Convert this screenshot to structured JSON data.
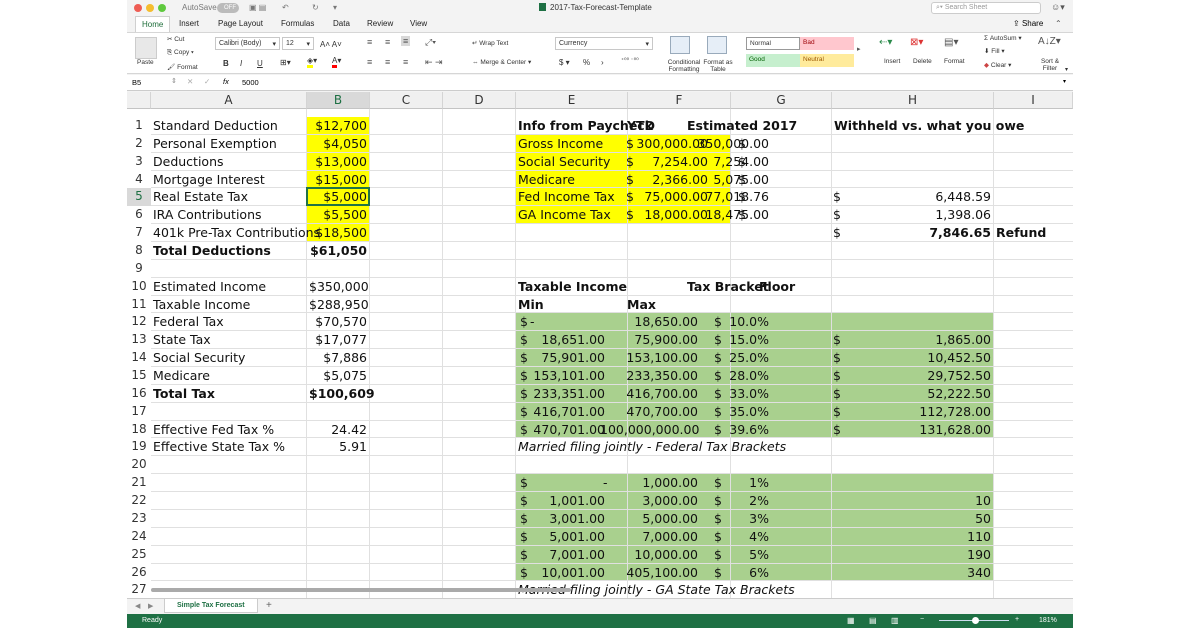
{
  "window": {
    "title": "2017-Tax-Forecast-Template",
    "autosave_label": "AutoSave",
    "autosave_state": "OFF",
    "search_placeholder": "Search Sheet",
    "share_label": "Share"
  },
  "ribbon_tabs": [
    "Home",
    "Insert",
    "Page Layout",
    "Formulas",
    "Data",
    "Review",
    "View"
  ],
  "active_tab": "Home",
  "ribbon": {
    "paste": "Paste",
    "cut": "Cut",
    "copy": "Copy",
    "format": "Format",
    "font_name": "Calibri (Body)",
    "font_size": "12",
    "bold": "B",
    "italic": "I",
    "underline": "U",
    "wrap_text": "Wrap Text",
    "merge_center": "Merge & Center",
    "number_format": "Currency",
    "currency_symbol": "$",
    "percent": "%",
    "comma": "›",
    "conditional_formatting": "Conditional Formatting",
    "format_as_table": "Format as Table",
    "styles": [
      {
        "label": "Normal",
        "bg": "#ffffff",
        "fg": "#000000"
      },
      {
        "label": "Bad",
        "bg": "#ffc7ce",
        "fg": "#9c0006"
      },
      {
        "label": "Good",
        "bg": "#c6efce",
        "fg": "#006100"
      },
      {
        "label": "Neutral",
        "bg": "#ffeb9c",
        "fg": "#9c5700"
      }
    ],
    "insert": "Insert",
    "delete": "Delete",
    "format_cells": "Format",
    "autosum": "AutoSum",
    "fill": "Fill",
    "clear": "Clear",
    "sort_filter": "Sort & Filter"
  },
  "formula_bar": {
    "name_box": "B5",
    "fx": "fx",
    "value": "5000"
  },
  "columns": [
    "A",
    "B",
    "C",
    "D",
    "E",
    "F",
    "G",
    "H",
    "I"
  ],
  "rows": [
    "1",
    "2",
    "3",
    "4",
    "5",
    "6",
    "7",
    "8",
    "9",
    "10",
    "11",
    "12",
    "13",
    "14",
    "15",
    "16",
    "17",
    "18",
    "19",
    "20",
    "21",
    "22",
    "23",
    "24",
    "25",
    "26",
    "27"
  ],
  "colors": {
    "yellow": "#ffff00",
    "green": "#a9d08e",
    "selected_border": "#217346",
    "accent": "#217346"
  },
  "left_table": [
    {
      "row": 1,
      "label": "Standard Deduction",
      "value": "$12,700",
      "hl": true
    },
    {
      "row": 2,
      "label": "Personal Exemption",
      "value": "$4,050",
      "hl": true
    },
    {
      "row": 3,
      "label": "Deductions",
      "value": "$13,000",
      "hl": true
    },
    {
      "row": 4,
      "label": "Mortgage Interest",
      "value": "$15,000",
      "hl": true
    },
    {
      "row": 5,
      "label": "Real Estate Tax",
      "value": "$5,000",
      "hl": true
    },
    {
      "row": 6,
      "label": "IRA Contributions",
      "value": "$5,500",
      "hl": true
    },
    {
      "row": 7,
      "label": "401k Pre-Tax Contributions",
      "value": "$18,500",
      "hl": true
    },
    {
      "row": 8,
      "label": "Total Deductions",
      "value": "$61,050",
      "bold": true
    },
    {
      "row": 10,
      "label": "Estimated Income",
      "value": "$350,000"
    },
    {
      "row": 11,
      "label": "Taxable Income",
      "value": "$288,950"
    },
    {
      "row": 12,
      "label": "Federal Tax",
      "value": "$70,570"
    },
    {
      "row": 13,
      "label": "State Tax",
      "value": "$17,077"
    },
    {
      "row": 14,
      "label": "Social Security",
      "value": "$7,886"
    },
    {
      "row": 15,
      "label": "Medicare",
      "value": "$5,075"
    },
    {
      "row": 16,
      "label": "Total Tax",
      "value": "$100,609",
      "bold": true
    },
    {
      "row": 18,
      "label": "Effective Fed Tax %",
      "value": "24.42"
    },
    {
      "row": 19,
      "label": "Effective State Tax %",
      "value": "5.91"
    }
  ],
  "paycheck": {
    "headers": {
      "e": "Info from Paycheck",
      "f": "YTD",
      "g": "Estimated 2017",
      "h": "Withheld vs. what you owe"
    },
    "rows": [
      {
        "label": "Gross Income",
        "ytd": "300,000.00",
        "est": "350,000.00",
        "diff": ""
      },
      {
        "label": "Social Security",
        "ytd": "7,254.00",
        "est": "7,254.00",
        "diff": ""
      },
      {
        "label": "Medicare",
        "ytd": "2,366.00",
        "est": "5,075.00",
        "diff": ""
      },
      {
        "label": "Fed Income Tax",
        "ytd": "75,000.00",
        "est": "77,018.76",
        "diff": "6,448.59"
      },
      {
        "label": "GA Income Tax",
        "ytd": "18,000.00",
        "est": "18,475.00",
        "diff": "1,398.06"
      }
    ],
    "total": "7,846.65",
    "total_label": "Refund"
  },
  "fed_brackets": {
    "title": "Taxable Income",
    "min": "Min",
    "max": "Max",
    "bracket": "Tax Bracket",
    "floor": "Floor",
    "rows": [
      {
        "min": "-",
        "max": "18,650.00",
        "rate": "10.0%",
        "floor": ""
      },
      {
        "min": "18,651.00",
        "max": "75,900.00",
        "rate": "15.0%",
        "floor": "1,865.00"
      },
      {
        "min": "75,901.00",
        "max": "153,100.00",
        "rate": "25.0%",
        "floor": "10,452.50"
      },
      {
        "min": "153,101.00",
        "max": "233,350.00",
        "rate": "28.0%",
        "floor": "29,752.50"
      },
      {
        "min": "233,351.00",
        "max": "416,700.00",
        "rate": "33.0%",
        "floor": "52,222.50"
      },
      {
        "min": "416,701.00",
        "max": "470,700.00",
        "rate": "35.0%",
        "floor": "112,728.00"
      },
      {
        "min": "470,701.00",
        "max": "100,000,000.00",
        "rate": "39.6%",
        "floor": "131,628.00"
      }
    ],
    "caption": "Married filing jointly - Federal Tax Brackets"
  },
  "ga_brackets": {
    "rows": [
      {
        "min": "-",
        "max": "1,000.00",
        "rate": "1%",
        "floor": ""
      },
      {
        "min": "1,001.00",
        "max": "3,000.00",
        "rate": "2%",
        "floor": "10"
      },
      {
        "min": "3,001.00",
        "max": "5,000.00",
        "rate": "3%",
        "floor": "50"
      },
      {
        "min": "5,001.00",
        "max": "7,000.00",
        "rate": "4%",
        "floor": "110"
      },
      {
        "min": "7,001.00",
        "max": "10,000.00",
        "rate": "5%",
        "floor": "190"
      },
      {
        "min": "10,001.00",
        "max": "405,100.00",
        "rate": "6%",
        "floor": "340"
      }
    ],
    "caption": "Married filing jointly - GA State Tax Brackets"
  },
  "sheet_tabs": [
    "Simple Tax Forecast"
  ],
  "status": {
    "text": "Ready",
    "zoom": "181%"
  }
}
